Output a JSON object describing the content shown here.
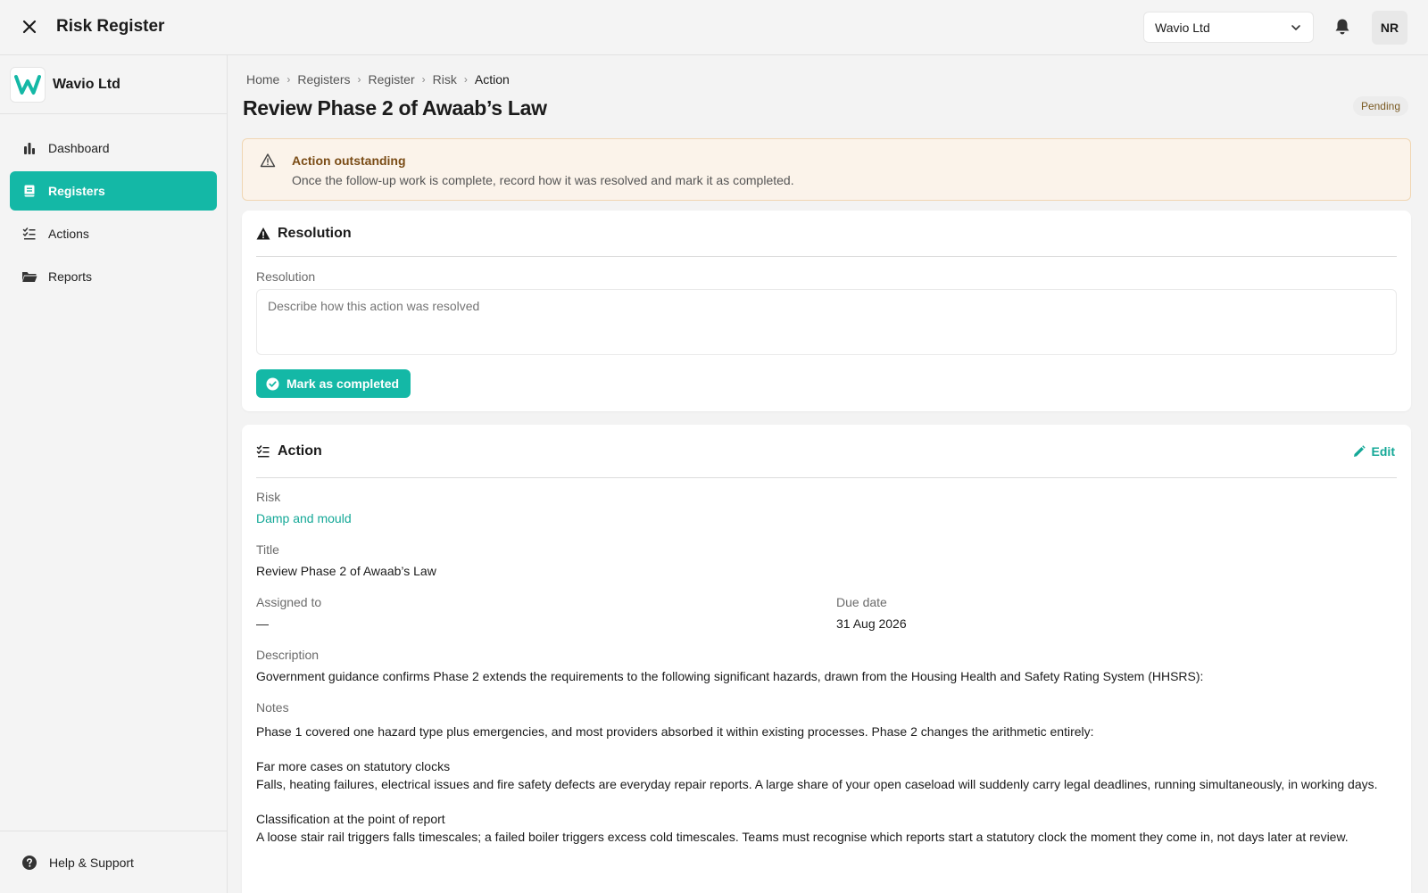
{
  "app": {
    "title": "Risk Register",
    "org_select_value": "Wavio Ltd",
    "avatar_initials": "NR"
  },
  "sidebar": {
    "org_name": "Wavio Ltd",
    "items": [
      {
        "label": "Dashboard",
        "icon": "bar-chart-icon",
        "active": false
      },
      {
        "label": "Registers",
        "icon": "book-icon",
        "active": true
      },
      {
        "label": "Actions",
        "icon": "list-check-icon",
        "active": false
      },
      {
        "label": "Reports",
        "icon": "folder-open-icon",
        "active": false
      }
    ],
    "help_label": "Help & Support"
  },
  "breadcrumb": {
    "home": "Home",
    "registers": "Registers",
    "register": "Register",
    "risk": "Risk",
    "current": "Action"
  },
  "page": {
    "title": "Review Phase 2 of Awaab’s Law",
    "status": "Pending"
  },
  "alert": {
    "title": "Action outstanding",
    "body": "Once the follow-up work is complete, record how it was resolved and mark it as completed."
  },
  "resolution": {
    "title": "Resolution",
    "field_label": "Resolution",
    "placeholder": "Describe how this action was resolved",
    "button_label": "Mark as completed"
  },
  "action": {
    "title": "Action",
    "edit_label": "Edit",
    "risk_label": "Risk",
    "risk_value": "Damp and mould",
    "title_label": "Title",
    "title_value": "Review Phase 2 of Awaab’s Law",
    "assigned_label": "Assigned to",
    "assigned_value": "—",
    "due_label": "Due date",
    "due_value": "31 Aug 2026",
    "description_label": "Description",
    "description_value": "Government guidance confirms Phase 2 extends the requirements to the following significant hazards, drawn from the Housing Health and Safety Rating System (HHSRS):",
    "notes_label": "Notes",
    "notes_intro": "Phase 1 covered one hazard type plus emergencies, and most providers absorbed it within existing processes. Phase 2 changes the arithmetic entirely:",
    "notes_h1": "Far more cases on statutory clocks",
    "notes_p1": "Falls, heating failures, electrical issues and fire safety defects are everyday repair reports. A large share of your open caseload will suddenly carry legal deadlines, running simultaneously, in working days.",
    "notes_h2": "Classification at the point of report",
    "notes_p2": "A loose stair rail triggers falls timescales; a failed boiler triggers excess cold timescales. Teams must recognise which reports start a statutory clock the moment they come in, not days later at review."
  },
  "colors": {
    "accent": "#14b8a6",
    "link": "#14a897",
    "alert_bg": "#fbf3ea",
    "alert_border": "#f0d6b3"
  }
}
